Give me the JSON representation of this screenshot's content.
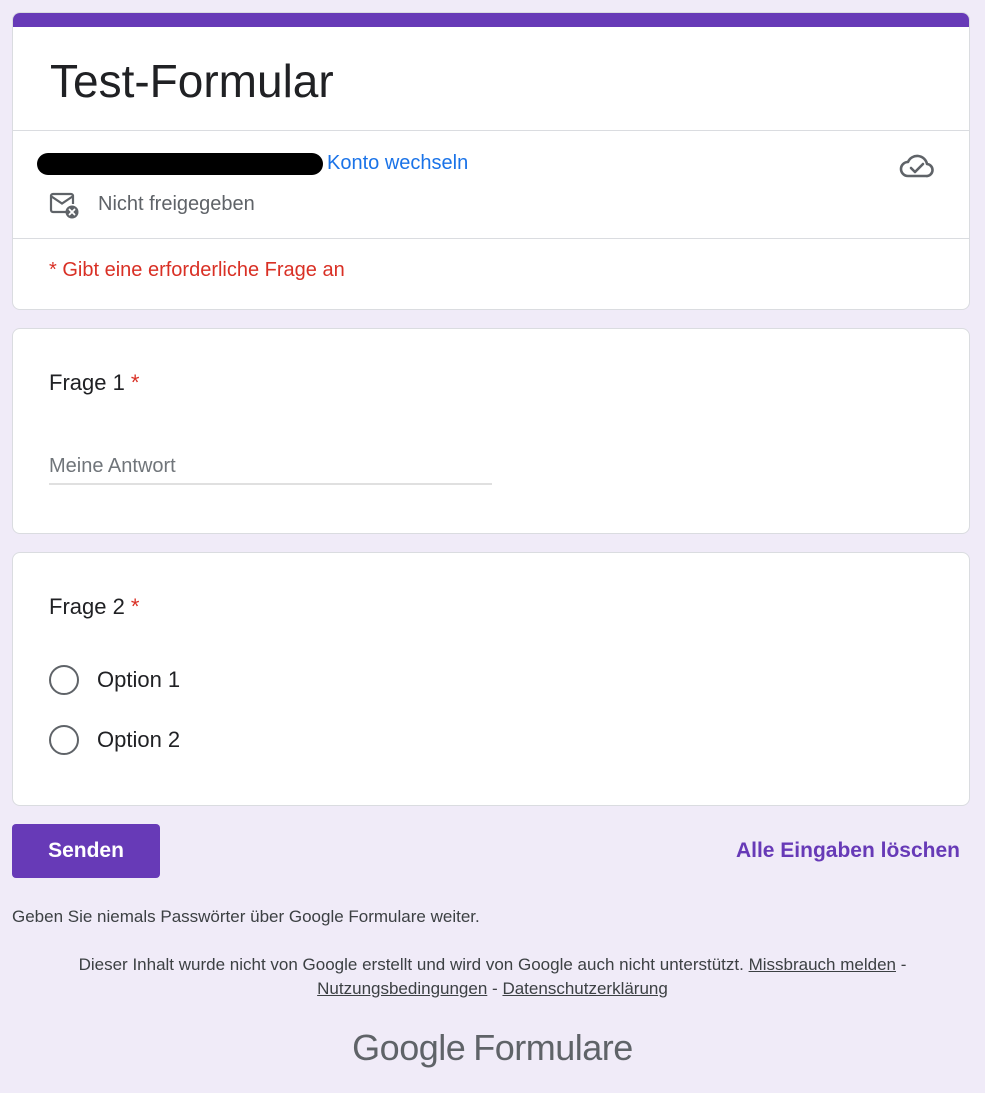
{
  "form": {
    "title": "Test-Formular",
    "switch_account": "Konto wechseln",
    "not_shared": "Nicht freigegeben",
    "required_note": "* Gibt eine erforderliche Frage an"
  },
  "questions": [
    {
      "title": "Frage 1",
      "required_mark": "*",
      "placeholder": "Meine Antwort"
    },
    {
      "title": "Frage 2",
      "required_mark": "*",
      "options": [
        "Option 1",
        "Option 2"
      ]
    }
  ],
  "actions": {
    "send_label": "Senden",
    "clear_label": "Alle Eingaben löschen"
  },
  "footer": {
    "password_note": "Geben Sie niemals Passwörter über Google Formulare weiter.",
    "disclaimer": "Dieser Inhalt wurde nicht von Google erstellt und wird von Google auch nicht unterstützt.",
    "report_abuse": "Missbrauch melden",
    "separator": "-",
    "terms": "Nutzungsbedingungen",
    "privacy": "Datenschutzerklärung",
    "brand_google": "Google",
    "brand_product": "Formulare"
  },
  "colors": {
    "accent": "#673ab7",
    "background": "#f0ebf8",
    "link": "#1a73e8",
    "required": "#d93025"
  }
}
